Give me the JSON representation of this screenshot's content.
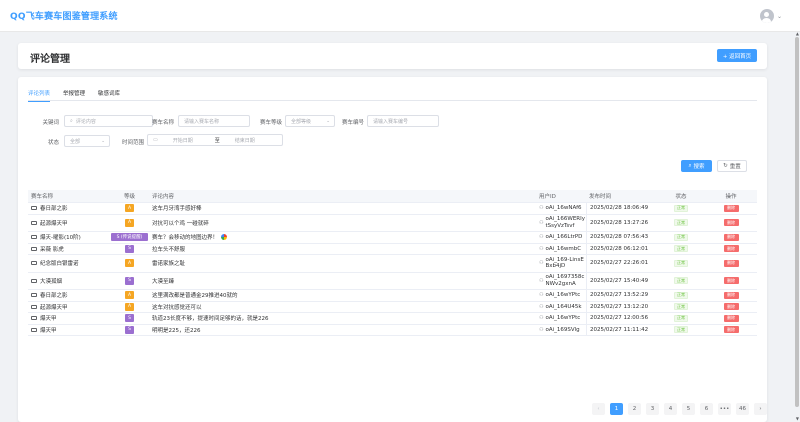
{
  "app": {
    "title": "QQ飞车赛车图鉴管理系统"
  },
  "header": {
    "title": "评论管理",
    "back_label": "+ 返回首页"
  },
  "tabs": [
    {
      "label": "评论列表",
      "active": true
    },
    {
      "label": "举报管理",
      "active": false
    },
    {
      "label": "敏感词库",
      "active": false
    }
  ],
  "filters": {
    "keyword": {
      "label": "关键词",
      "placeholder": "评论内容"
    },
    "car_name": {
      "label": "赛车名称",
      "placeholder": "请输入赛车名称"
    },
    "car_grade": {
      "label": "赛车等级",
      "value": "全部等级"
    },
    "car_no": {
      "label": "赛车编号",
      "placeholder": "请输入赛车编号"
    },
    "status": {
      "label": "状态",
      "value": "全部"
    },
    "time_range": {
      "label": "时间范围",
      "start_placeholder": "开始日期",
      "separator": "至",
      "end_placeholder": "结束日期"
    }
  },
  "buttons": {
    "search": "搜索",
    "reset": "重置"
  },
  "table": {
    "columns": [
      "赛车名称",
      "等级",
      "评论内容",
      "用户ID",
      "发布时间",
      "状态",
      "操作"
    ],
    "rows": [
      {
        "car": "春日部之影",
        "grade": "A",
        "grade_class": "a",
        "content": "这车月牙湾手感好棒",
        "user": "oAi_16wNAf6",
        "time": "2025/02/28 18:06:49",
        "status": "正常",
        "action": "删除",
        "tall": false,
        "emoji": false
      },
      {
        "car": "起源爆天甲",
        "grade": "A",
        "grade_class": "a",
        "content": "对抗可以个鸡 一碰就碎",
        "user": "oAi_166WERIytSsyVzTsvf",
        "time": "2025/02/28 13:27:26",
        "status": "正常",
        "action": "删除",
        "tall": true,
        "emoji": false
      },
      {
        "car": "爆天-曜影(10阶)",
        "grade": "S (传说提醒)",
        "grade_class": "s wide",
        "content": "赛车？会移动的地图边界！",
        "user": "oAi_166LtrPD",
        "time": "2025/02/28 07:56:43",
        "status": "正常",
        "action": "删除",
        "tall": false,
        "emoji": true
      },
      {
        "car": "采薇 影虎",
        "grade": "S",
        "grade_class": "s",
        "content": "拉车头不舒服",
        "user": "oAi_16wmbC",
        "time": "2025/02/28 06:12:01",
        "status": "正常",
        "action": "删除",
        "tall": false,
        "emoji": false
      },
      {
        "car": "纪念版白银雷诺",
        "grade": "A",
        "grade_class": "a",
        "content": "雷诺家族之耻",
        "user": "oAi_169-LinsEBxb4jD",
        "time": "2025/02/27 22:26:01",
        "status": "正常",
        "action": "删除",
        "tall": true,
        "emoji": false
      },
      {
        "car": "大漠孤烟",
        "grade": "S",
        "grade_class": "s",
        "content": "大漠至臻",
        "user": "oAi_1697358cNWv2gxnA",
        "time": "2025/02/27 15:40:49",
        "status": "正常",
        "action": "删除",
        "tall": true,
        "emoji": false
      },
      {
        "car": "春日部之影",
        "grade": "A",
        "grade_class": "a",
        "content": "这里满改都是普通金29推进40就的",
        "user": "oAi_16wYPtc",
        "time": "2025/02/27 13:52:29",
        "status": "正常",
        "action": "删除",
        "tall": false,
        "emoji": false
      },
      {
        "car": "起源爆天甲",
        "grade": "A",
        "grade_class": "a",
        "content": "这车对抗感觉还可以",
        "user": "oAi_164U45k",
        "time": "2025/02/27 13:12:20",
        "status": "正常",
        "action": "删除",
        "tall": false,
        "emoji": false
      },
      {
        "car": "爆天甲",
        "grade": "S",
        "grade_class": "s",
        "content": "轨道23长度不够，提速时间足够的话，就是226",
        "user": "oAi_16wYPtc",
        "time": "2025/02/27 12:00:56",
        "status": "正常",
        "action": "删除",
        "tall": false,
        "emoji": false
      },
      {
        "car": "爆天甲",
        "grade": "S",
        "grade_class": "s",
        "content": "明明是225，还226",
        "user": "oAi_169SVlg",
        "time": "2025/02/27 11:11:42",
        "status": "正常",
        "action": "删除",
        "tall": false,
        "emoji": false
      }
    ]
  },
  "pagination": {
    "prev": "‹",
    "pages": [
      "1",
      "2",
      "3",
      "4",
      "5",
      "6",
      "•••",
      "46"
    ],
    "active": "1",
    "next": "›"
  }
}
